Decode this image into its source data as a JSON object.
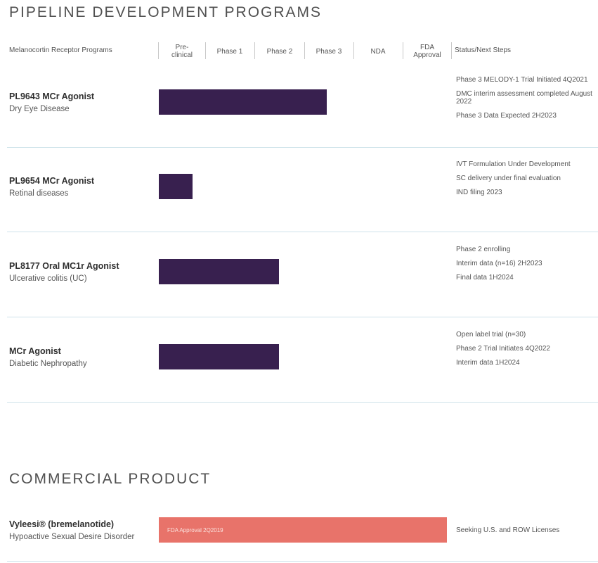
{
  "titles": {
    "pipeline": "PIPELINE DEVELOPMENT PROGRAMS",
    "commercial": "COMMERCIAL PRODUCT"
  },
  "header": {
    "programs": "Melanocortin Receptor Programs",
    "phases": [
      "Pre-clinical",
      "Phase 1",
      "Phase 2",
      "Phase 3",
      "NDA",
      "FDA Approval"
    ],
    "status": "Status/Next Steps"
  },
  "colors": {
    "pipeline_bar": "#38204f",
    "commercial_bar": "#e8736a",
    "divider": "#cfe3ea"
  },
  "chart_data": {
    "type": "bar",
    "orientation": "horizontal",
    "stages": [
      "Pre-clinical",
      "Phase 1",
      "Phase 2",
      "Phase 3",
      "NDA",
      "FDA Approval"
    ],
    "programs": [
      {
        "name": "PL9643 MCr Agonist",
        "indication": "Dry Eye Disease",
        "stage_reached": "Phase 3",
        "progress_stages": 3.5,
        "steps": [
          "Phase 3 MELODY-1 Trial Initiated 4Q2021",
          "DMC interim assessment completed August 2022",
          "Phase 3 Data Expected 2H2023"
        ]
      },
      {
        "name": "PL9654 MCr Agonist",
        "indication": "Retinal diseases",
        "stage_reached": "Pre-clinical",
        "progress_stages": 0.7,
        "steps": [
          "IVT Formulation Under Development",
          "SC delivery under final evaluation",
          "IND filing 2023"
        ]
      },
      {
        "name": "PL8177 Oral MC1r Agonist",
        "indication": "Ulcerative colitis (UC)",
        "stage_reached": "Phase 2",
        "progress_stages": 2.5,
        "steps": [
          "Phase 2 enrolling",
          "Interim data (n=16) 2H2023",
          "Final data 1H2024"
        ]
      },
      {
        "name": "MCr Agonist",
        "indication": "Diabetic Nephropathy",
        "stage_reached": "Phase 2",
        "progress_stages": 2.5,
        "steps": [
          "Open label trial (n=30)",
          "Phase 2 Trial Initiates 4Q2022",
          "Interim data 1H2024"
        ]
      }
    ],
    "commercial": [
      {
        "name": "Vyleesi® (bremelanotide)",
        "indication": "Hypoactive Sexual Desire Disorder",
        "bar_label": "FDA Approval 2Q2019",
        "progress_stages": 6,
        "steps": [
          "Seeking U.S. and ROW Licenses"
        ]
      }
    ]
  }
}
